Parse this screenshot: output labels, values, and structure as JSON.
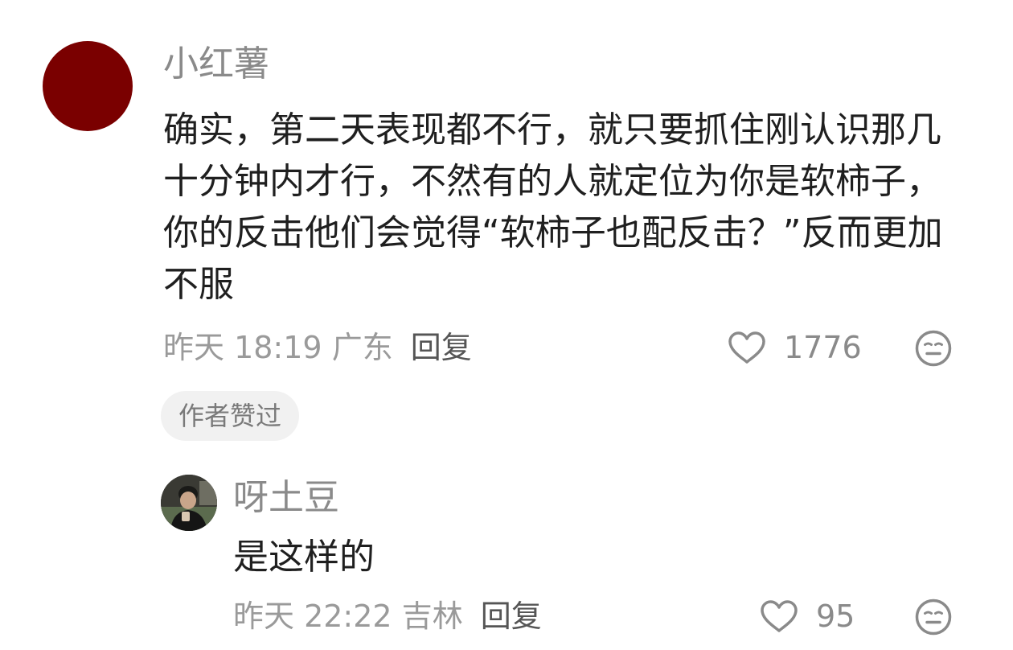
{
  "comment": {
    "username": "小红薯",
    "avatar_color": "#7a0000",
    "content": "确实，第二天表现都不行，就只要抓住刚认识那几十分钟内才行，不然有的人就定位为你是软柿子，你的反击他们会觉得“软柿子也配反击？”反而更加不服",
    "time": "昨天 18:19",
    "location": "广东",
    "reply_label": "回复",
    "like_count": "1776",
    "like_icon": "heart-outline-icon",
    "dislike_icon": "meh-face-icon",
    "author_badge": "作者赞过"
  },
  "reply": {
    "username": "呀土豆",
    "content": "是这样的",
    "time": "昨天 22:22",
    "location": "吉林",
    "reply_label": "回复",
    "like_count": "95",
    "like_icon": "heart-outline-icon",
    "dislike_icon": "meh-face-icon"
  },
  "colors": {
    "text_primary": "#1f1f1f",
    "text_secondary": "#8a8a8a",
    "badge_bg": "#f1f1f1"
  }
}
